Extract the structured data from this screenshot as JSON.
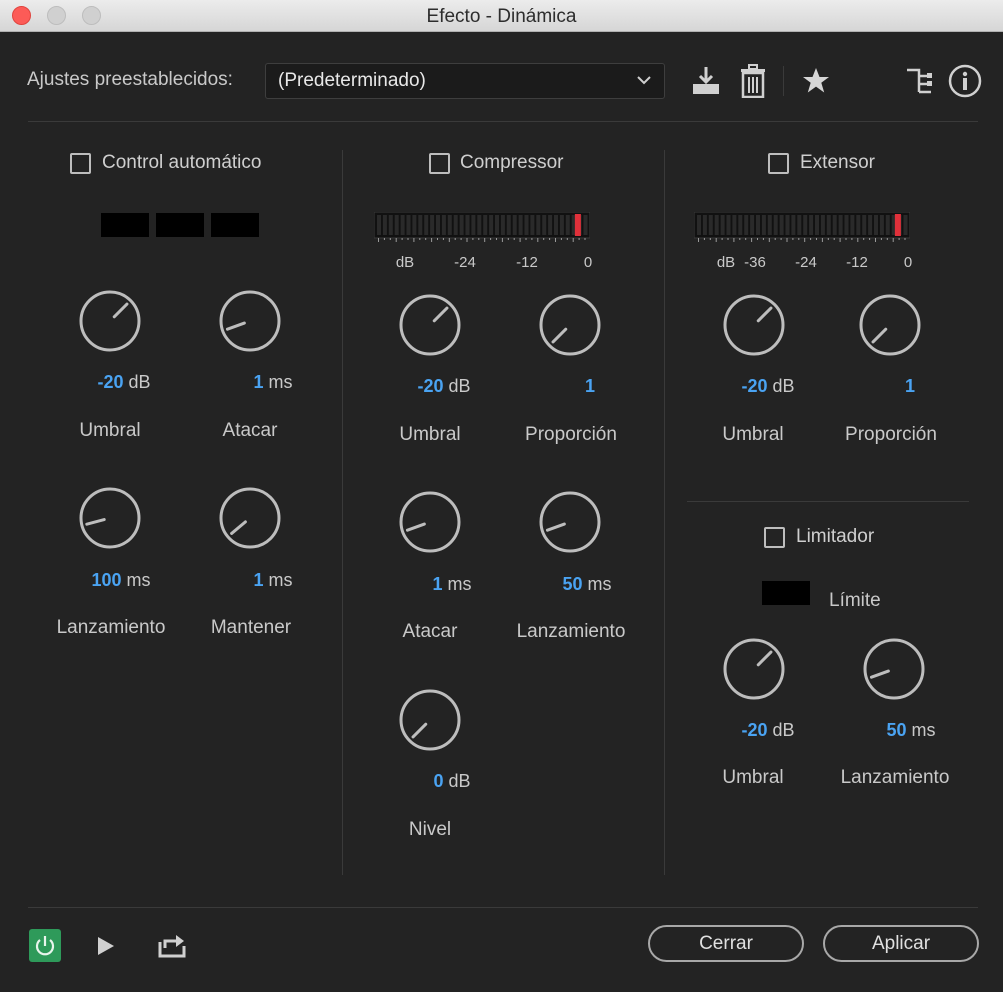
{
  "window": {
    "title": "Efecto - Dinámica"
  },
  "presets": {
    "label": "Ajustes preestablecidos:",
    "value": "(Predeterminado)"
  },
  "toolbar_icons": [
    "download-icon",
    "trash-icon",
    "star-icon",
    "routing-icon",
    "info-icon"
  ],
  "auto": {
    "title": "Control automático",
    "knobs": [
      {
        "value": "-20",
        "unit": "dB",
        "label": "Umbral"
      },
      {
        "value": "1",
        "unit": "ms",
        "label": "Atacar"
      },
      {
        "value": "100",
        "unit": "ms",
        "label": "Lanzamiento"
      },
      {
        "value": "1",
        "unit": "ms",
        "label": "Mantener"
      }
    ]
  },
  "compressor": {
    "title": "Compressor",
    "meter_ticks": [
      "dB",
      "-24",
      "-12",
      "0"
    ],
    "knobs": [
      {
        "value": "-20",
        "unit": "dB",
        "label": "Umbral"
      },
      {
        "value": "1",
        "unit": "",
        "label": "Proporción"
      },
      {
        "value": "1",
        "unit": "ms",
        "label": "Atacar"
      },
      {
        "value": "50",
        "unit": "ms",
        "label": "Lanzamiento"
      },
      {
        "value": "0",
        "unit": "dB",
        "label": "Nivel"
      }
    ]
  },
  "expander": {
    "title": "Extensor",
    "meter_ticks": [
      "dB",
      "-36",
      "-24",
      "-12",
      "0"
    ],
    "knobs": [
      {
        "value": "-20",
        "unit": "dB",
        "label": "Umbral"
      },
      {
        "value": "1",
        "unit": "",
        "label": "Proporción"
      }
    ]
  },
  "limiter": {
    "title": "Limitador",
    "limit_label": "Límite",
    "knobs": [
      {
        "value": "-20",
        "unit": "dB",
        "label": "Umbral"
      },
      {
        "value": "50",
        "unit": "ms",
        "label": "Lanzamiento"
      }
    ]
  },
  "buttons": {
    "close": "Cerrar",
    "apply": "Aplicar"
  },
  "colors": {
    "accent_value": "#4aa3f2",
    "power_on": "#2e9a5a",
    "meter_peak": "#e0303a"
  }
}
